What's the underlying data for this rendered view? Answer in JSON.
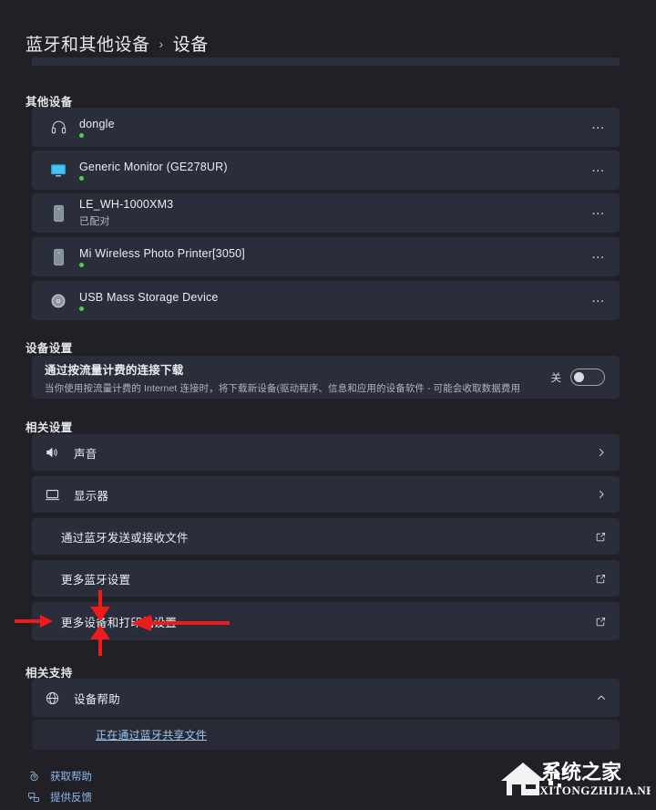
{
  "breadcrumb": {
    "root": "蓝牙和其他设备",
    "separator": "›",
    "current": "设备"
  },
  "sections": {
    "other_devices_title": "其他设备",
    "device_settings_title": "设备设置",
    "related_settings_title": "相关设置",
    "related_support_title": "相关支持"
  },
  "devices": [
    {
      "name": "dongle",
      "status": "",
      "icon": "headphones-icon",
      "has_dot": true,
      "more": "…"
    },
    {
      "name": "Generic Monitor (GE278UR)",
      "status": "",
      "icon": "monitor-icon",
      "has_dot": true,
      "more": "…"
    },
    {
      "name": "LE_WH-1000XM3",
      "status": "已配对",
      "icon": "phone-icon",
      "has_dot": false,
      "more": "…"
    },
    {
      "name": "Mi Wireless Photo Printer[3050]",
      "status": "",
      "icon": "phone-icon",
      "has_dot": true,
      "more": "…"
    },
    {
      "name": "USB Mass Storage Device",
      "status": "",
      "icon": "disc-drive-icon",
      "has_dot": true,
      "more": "…"
    }
  ],
  "metered": {
    "title": "通过按流量计费的连接下载",
    "description": "当你使用按流量计费的 Internet 连接时，将下载新设备(驱动程序、信息和应用的设备软件 - 可能会收取数据费用",
    "state_label": "关"
  },
  "related_settings": [
    {
      "label": "声音",
      "icon": "speaker-icon",
      "action": "chevron-right-icon"
    },
    {
      "label": "显示器",
      "icon": "display-icon",
      "action": "chevron-right-icon"
    },
    {
      "label": "通过蓝牙发送或接收文件",
      "icon": "",
      "action": "external-link-icon"
    },
    {
      "label": "更多蓝牙设置",
      "icon": "",
      "action": "external-link-icon"
    },
    {
      "label": "更多设备和打印机设置",
      "icon": "",
      "action": "external-link-icon"
    }
  ],
  "related_support": {
    "help_label": "设备帮助",
    "help_icon": "globe-icon",
    "expand_icon": "chevron-up-icon",
    "sub_link": "正在通过蓝牙共享文件"
  },
  "footer": [
    {
      "label": "获取帮助",
      "icon": "help-icon"
    },
    {
      "label": "提供反馈",
      "icon": "feedback-icon"
    }
  ],
  "watermark": {
    "title": "系统之家",
    "url": "XITONGZHIJIA.NET"
  },
  "colors": {
    "background": "#202026",
    "card": "#2a2d3a",
    "accent_link": "#8fb8e8",
    "status_dot": "#4fd14f",
    "annotation": "#ee1b1b"
  }
}
